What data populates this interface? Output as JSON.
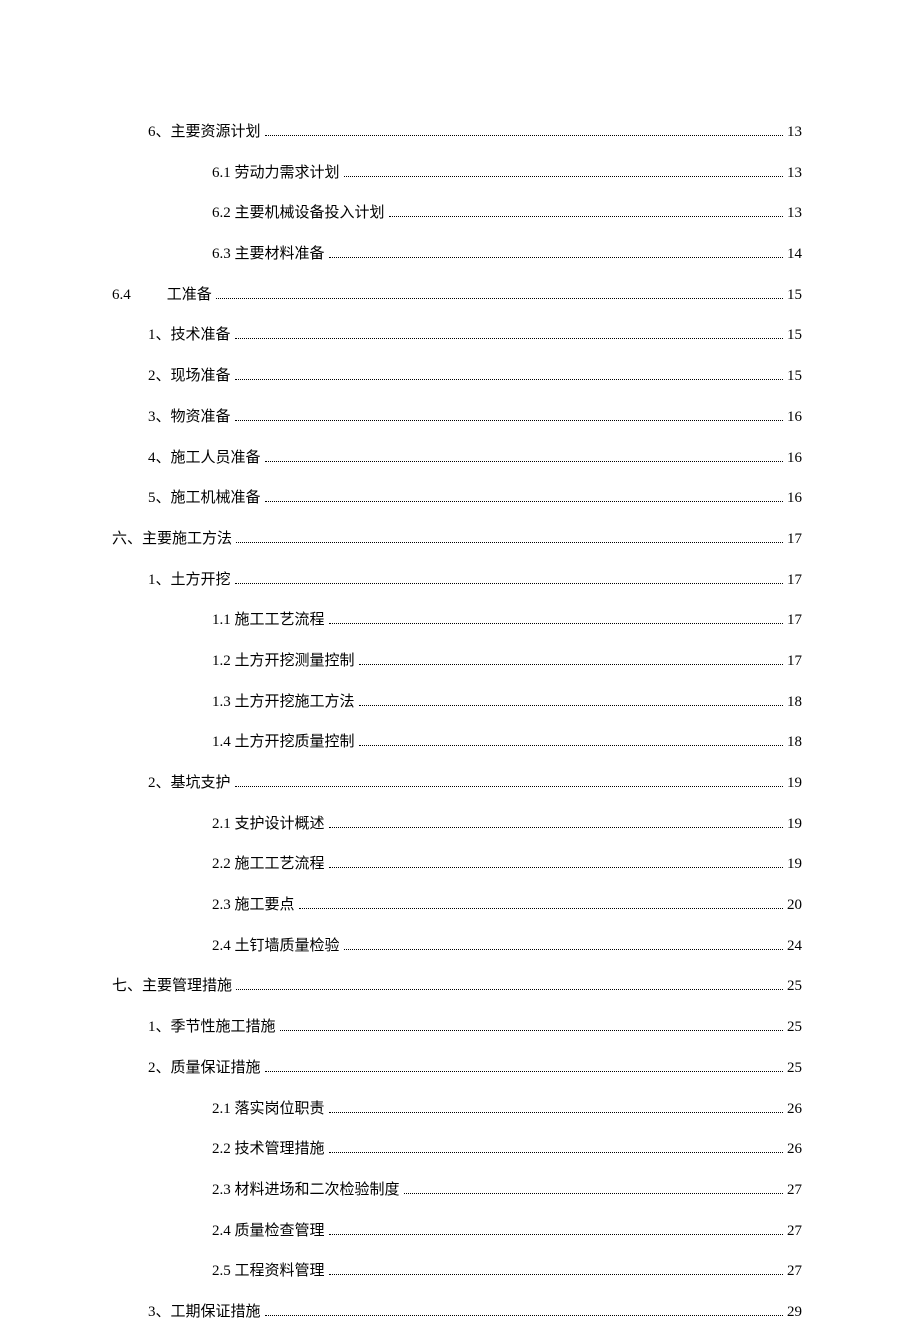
{
  "toc": [
    {
      "level": 1,
      "label": "6、主要资源计划",
      "page": "13"
    },
    {
      "level": 2,
      "label": "6.1  劳动力需求计划",
      "page": "13"
    },
    {
      "level": 2,
      "label": "6.2  主要机械设备投入计划",
      "page": "13"
    },
    {
      "level": 2,
      "label": "6.3  主要材料准备",
      "page": "14"
    },
    {
      "level": "special",
      "pre": "6.4",
      "label": "工准备",
      "page": "15"
    },
    {
      "level": 1,
      "label": "1、技术准备",
      "page": "15"
    },
    {
      "level": 1,
      "label": "2、现场准备",
      "page": "15"
    },
    {
      "level": 1,
      "label": "3、物资准备",
      "page": "16"
    },
    {
      "level": 1,
      "label": "4、施工人员准备",
      "page": "16"
    },
    {
      "level": 1,
      "label": "5、施工机械准备",
      "page": "16"
    },
    {
      "level": 0,
      "label": "六、主要施工方法",
      "page": "17"
    },
    {
      "level": 1,
      "label": "1、土方开挖",
      "page": "17"
    },
    {
      "level": 2,
      "label": "1.1  施工工艺流程",
      "page": "17"
    },
    {
      "level": 2,
      "label": "1.2  土方开挖测量控制",
      "page": "17"
    },
    {
      "level": 2,
      "label": "1.3  土方开挖施工方法",
      "page": "18"
    },
    {
      "level": 2,
      "label": "1.4  土方开挖质量控制",
      "page": "18"
    },
    {
      "level": 1,
      "label": "2、基坑支护",
      "page": "19"
    },
    {
      "level": 2,
      "label": "2.1  支护设计概述",
      "page": "19"
    },
    {
      "level": 2,
      "label": "2.2  施工工艺流程",
      "page": "19"
    },
    {
      "level": 2,
      "label": "2.3  施工要点",
      "page": "20"
    },
    {
      "level": 2,
      "label": "2.4  土钉墙质量检验",
      "page": "24"
    },
    {
      "level": 0,
      "label": "七、主要管理措施",
      "page": "25"
    },
    {
      "level": 1,
      "label": "1、季节性施工措施",
      "page": "25"
    },
    {
      "level": 1,
      "label": "2、质量保证措施",
      "page": "25"
    },
    {
      "level": 2,
      "label": "2.1  落实岗位职责",
      "page": "26"
    },
    {
      "level": 2,
      "label": "2.2  技术管理措施",
      "page": "26"
    },
    {
      "level": 2,
      "label": "2.3  材料进场和二次检验制度",
      "page": "27"
    },
    {
      "level": 2,
      "label": "2.4  质量检查管理",
      "page": "27"
    },
    {
      "level": 2,
      "label": "2.5  工程资料管理",
      "page": "27"
    },
    {
      "level": 1,
      "label": "3、工期保证措施",
      "page": "29"
    }
  ]
}
